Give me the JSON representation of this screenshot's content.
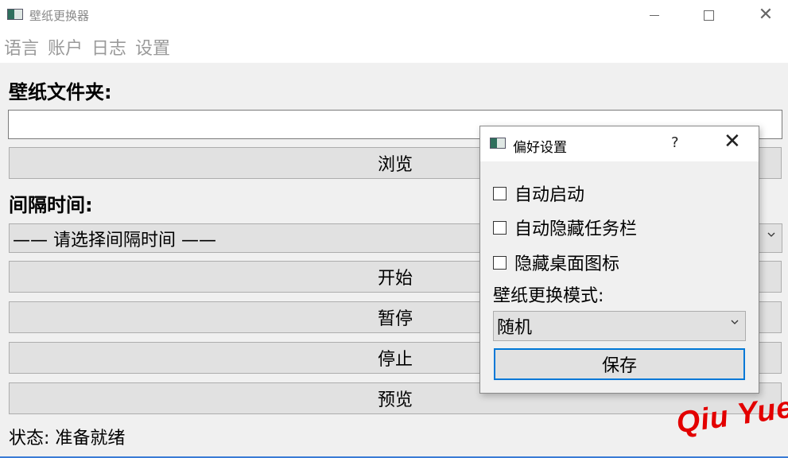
{
  "window": {
    "title": "壁纸更换器",
    "close_glyph": "✕"
  },
  "menu": [
    "语言",
    "账户",
    "日志",
    "设置"
  ],
  "main": {
    "folder_label": "壁纸文件夹:",
    "folder_value": "",
    "browse_label": "浏览",
    "interval_label": "间隔时间:",
    "interval_selected": "—— 请选择间隔时间 ——",
    "start_label": "开始",
    "pause_label": "暂停",
    "stop_label": "停止",
    "preview_label": "预览",
    "status_text": "状态: 准备就绪"
  },
  "watermark": "Qiu Yue",
  "dialog": {
    "title": "偏好设置",
    "help_glyph": "?",
    "close_glyph": "✕",
    "options": [
      {
        "label": "自动启动",
        "checked": false
      },
      {
        "label": "自动隐藏任务栏",
        "checked": false
      },
      {
        "label": "隐藏桌面图标",
        "checked": false
      }
    ],
    "mode_label": "壁纸更换模式:",
    "mode_selected": "随机",
    "save_label": "保存"
  },
  "colors": {
    "accent": "#0078d7",
    "watermark": "#e30000",
    "button_bg": "#e1e1e1",
    "window_bg": "#f0f0f0"
  },
  "icons": [
    "app-icon",
    "minimize-icon",
    "maximize-icon",
    "close-icon",
    "chevron-down-icon",
    "help-icon"
  ]
}
